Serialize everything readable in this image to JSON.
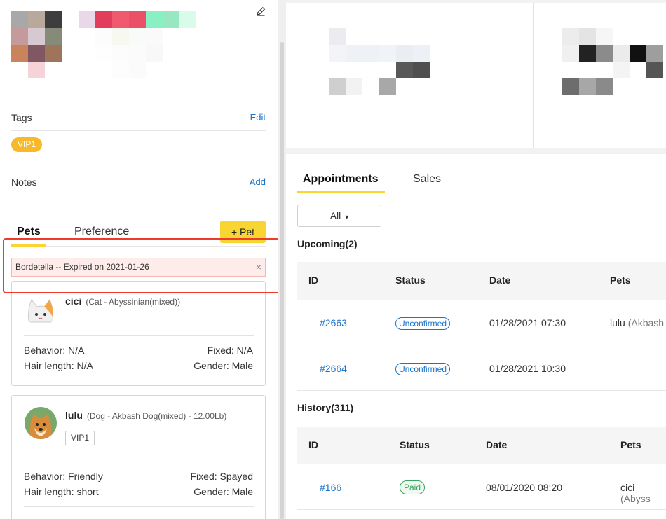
{
  "colors": {
    "accent": "#f8d531",
    "link": "#1a73c8",
    "alert_bg": "#fdecea",
    "highlight": "#ee3b2b",
    "paid": "#3aa35f",
    "vip_tag": "#f7b928"
  },
  "profile": {
    "edit_icon": "pencil-icon",
    "avatar_mosaic": [
      "#a8a8a8",
      "#b8a99c",
      "#3d3d3d",
      "#c49a9a",
      "#d7c9d1",
      "#868b79",
      "#c9845b",
      "#7f5863",
      "#9e7558",
      "#ffffff",
      "#f5d3d8",
      "#ffffff"
    ],
    "name_mosaic": [
      "#e8d8e8",
      "#e33d5c",
      "#f05a6f",
      "#ea5168",
      "#88f0c2",
      "#97e8c0",
      "#d9fbe9",
      "#ffffff",
      "#fcfcfc",
      "#f7f9f1",
      "#f9fbf9",
      "#fafafa",
      "#ffffff",
      "#ffffff",
      "#ffffff",
      "#fefefe",
      "#fcfcfc",
      "#fbfbfb",
      "#f8f8f8",
      "#ffffff",
      "#ffffff",
      "#ffffff",
      "#ffffff",
      "#fdfdfd",
      "#fbfbfb",
      "#ffffff",
      "#ffffff",
      "#ffffff"
    ]
  },
  "tags": {
    "title": "Tags",
    "edit_label": "Edit",
    "items": [
      "VIP1"
    ]
  },
  "notes": {
    "title": "Notes",
    "add_label": "Add"
  },
  "pets_tabs": {
    "pets": "Pets",
    "preference": "Preference",
    "add_pet": "+ Pet"
  },
  "alert": {
    "text": "Bordetella -- Expired on 2021-01-26",
    "close": "×"
  },
  "pets": [
    {
      "name": "cici",
      "meta": "(Cat - Abyssinian(mixed))",
      "behavior": "Behavior: N/A",
      "fixed": "Fixed: N/A",
      "hair": "Hair length: N/A",
      "gender": "Gender: Male"
    },
    {
      "name": "lulu",
      "meta": "(Dog - Akbash Dog(mixed) - 12.00Lb)",
      "tag": "VIP1",
      "behavior": "Behavior: Friendly",
      "fixed": "Fixed: Spayed",
      "hair": "Hair length: short",
      "gender": "Gender: Male"
    }
  ],
  "top_cards": {
    "left_mosaic": [
      "#ffffff",
      "#ececf0",
      "#ffffff",
      "#ffffff",
      "#ffffff",
      "#ffffff",
      "#ffffff",
      "#ffffff",
      "#f2f4f8",
      "#eef2f7",
      "#eef2f7",
      "#f0f3f7",
      "#eaeef2",
      "#edf0f4",
      "#ffffff",
      "#ffffff",
      "#ffffff",
      "#ffffff",
      "#ffffff",
      "#585858",
      "#4f4f4f",
      "#ffffff",
      "#cfcfcf",
      "#f2f2f2",
      "#ffffff",
      "#a8a8a8",
      "#ffffff",
      "#ffffff"
    ],
    "right_mosaic": [
      "#ffffff",
      "#ececec",
      "#e4e4e4",
      "#f6f6f6",
      "#ffffff",
      "#ffffff",
      "#ffffff",
      "#ffffff",
      "#f0f0f0",
      "#222222",
      "#8b8b8b",
      "#ebebeb",
      "#111111",
      "#9e9e9e",
      "#ffffff",
      "#ffffff",
      "#ffffff",
      "#ffffff",
      "#f4f4f4",
      "#ffffff",
      "#555555",
      "#ffffff",
      "#6d6d6d",
      "#a7a7a7",
      "#8a8a8a",
      "#ffffff",
      "#ffffff",
      "#ffffff"
    ]
  },
  "main_tabs": {
    "appointments": "Appointments",
    "sales": "Sales"
  },
  "filter": {
    "value": "All",
    "chevron": "▾"
  },
  "upcoming": {
    "title": "Upcoming(2)",
    "columns": [
      "ID",
      "Status",
      "Date",
      "Pets"
    ],
    "rows": [
      {
        "id": "#2663",
        "status": "Unconfirmed",
        "date": "01/28/2021 07:30",
        "pet": "lulu",
        "pet_sub": "(Akbash"
      },
      {
        "id": "#2664",
        "status": "Unconfirmed",
        "date": "01/28/2021 10:30",
        "pet": "",
        "pet_sub": ""
      }
    ]
  },
  "history": {
    "title": "History(311)",
    "columns": [
      "ID",
      "Status",
      "Date",
      "Pets"
    ],
    "rows": [
      {
        "id": "#166",
        "status": "Paid",
        "date": "08/01/2020 08:20",
        "pet": "cici",
        "pet_sub": "(Abyss"
      }
    ]
  }
}
